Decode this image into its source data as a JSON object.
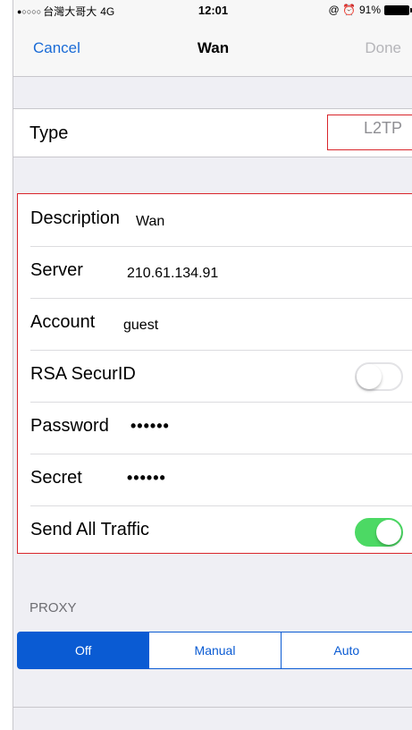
{
  "status_bar": {
    "signal": "●○○○○",
    "carrier": "台灣大哥大",
    "network": "4G",
    "time": "12:01",
    "icons": "@ ⏰",
    "battery": "91%"
  },
  "nav": {
    "cancel_label": "Cancel",
    "title": "Wan",
    "done_label": "Done"
  },
  "type_row": {
    "label": "Type",
    "value": "L2TP"
  },
  "fields": {
    "description": {
      "label": "Description",
      "value": "Wan"
    },
    "server": {
      "label": "Server",
      "value": "210.61.134.91"
    },
    "account": {
      "label": "Account",
      "value": "guest"
    },
    "rsa": {
      "label": "RSA SecurID",
      "enabled": false
    },
    "password": {
      "label": "Password",
      "value": "••••••"
    },
    "secret": {
      "label": "Secret",
      "value": "••••••"
    },
    "send_all": {
      "label": "Send All Traffic",
      "enabled": true
    }
  },
  "proxy": {
    "header": "PROXY",
    "options": [
      "Off",
      "Manual",
      "Auto"
    ],
    "selected": "Off"
  },
  "colors": {
    "accent_blue": "#1a6bd6",
    "segment_blue": "#0a5bd3",
    "highlight_red": "#d9252b",
    "toggle_green": "#4cd964"
  }
}
